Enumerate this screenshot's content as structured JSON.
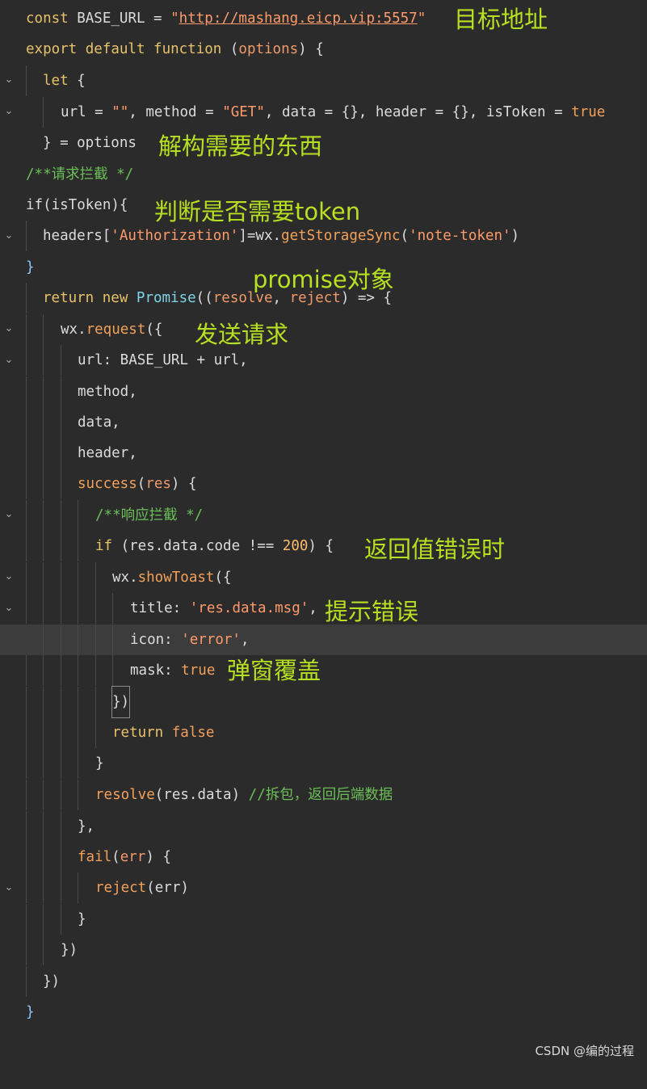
{
  "colors": {
    "background": "#2b2b2b",
    "current_line": "#3c3c3c",
    "keyword": "#e8c26a",
    "string": "#ff9a6a",
    "comment": "#6bbf59",
    "annotation": "#b6e021"
  },
  "icons": {
    "fold": "chevron-down-icon"
  },
  "code": {
    "l1_const": "const",
    "l1_name": " BASE_URL = ",
    "l1_q1": "\"",
    "l1_url": "http://mashang.eicp.vip:5557",
    "l1_q2": "\"",
    "l2_kw": "export default function",
    "l2_rest": " (",
    "l2_param": "options",
    "l2_end": ") {",
    "l3_kw": "let",
    "l3_rest": " {",
    "l4_a": "url = ",
    "l4_s1": "\"\"",
    "l4_b": ", method = ",
    "l4_s2": "\"GET\"",
    "l4_c": ", data = {}, header = {}, isToken = ",
    "l4_true": "true",
    "l5": "} = options",
    "l6_comment": "/**请求拦截 */",
    "l7": "if(isToken){",
    "l8_a": "headers[",
    "l8_s1": "'Authorization'",
    "l8_b": "]=wx.",
    "l8_fn": "getStorageSync",
    "l8_c": "(",
    "l8_s2": "'note-token'",
    "l8_d": ")",
    "l9": "}",
    "l10_kw": "return",
    "l10_new": " new",
    "l10_cls": " Promise",
    "l10_a": "((",
    "l10_p1": "resolve",
    "l10_b": ", ",
    "l10_p2": "reject",
    "l10_c": ") => {",
    "l11_a": "wx.",
    "l11_fn": "request",
    "l11_b": "({",
    "l12": "url: BASE_URL + url,",
    "l13": "method,",
    "l14": "data,",
    "l15": "header,",
    "l16_fn": "success",
    "l16_a": "(",
    "l16_p": "res",
    "l16_b": ") {",
    "l17_comment": "/**响应拦截 */",
    "l18_kw": "if",
    "l18_a": " (res.data.code !== ",
    "l18_num": "200",
    "l18_b": ") {",
    "l19_a": "wx.",
    "l19_fn": "showToast",
    "l19_b": "({",
    "l20_a": "title: ",
    "l20_s": "'res.data.msg'",
    "l20_b": ",",
    "l21_a": "icon: ",
    "l21_s": "'error'",
    "l21_b": ",",
    "l22_a": "mask: ",
    "l22_true": "true",
    "l23": "})",
    "l24_kw": "return",
    "l24_false": " false",
    "l25": "}",
    "l26_fn": "resolve",
    "l26_a": "(res.data) ",
    "l26_comment": "//拆包，返回后端数据",
    "l27": "},",
    "l28_fn": "fail",
    "l28_a": "(",
    "l28_p": "err",
    "l28_b": ") {",
    "l29_fn": "reject",
    "l29_a": "(err)",
    "l30": "}",
    "l31": "})",
    "l32": "})",
    "l33": "}"
  },
  "annotations": {
    "target": "目标地址",
    "destructure": "解构需要的东西",
    "token_check": "判断是否需要token",
    "promise": "promise对象",
    "send": "发送请求",
    "error_return": "返回值错误时",
    "tip_error": "提示错误",
    "mask_cover": "弹窗覆盖"
  },
  "watermark": "CSDN @编的过程"
}
